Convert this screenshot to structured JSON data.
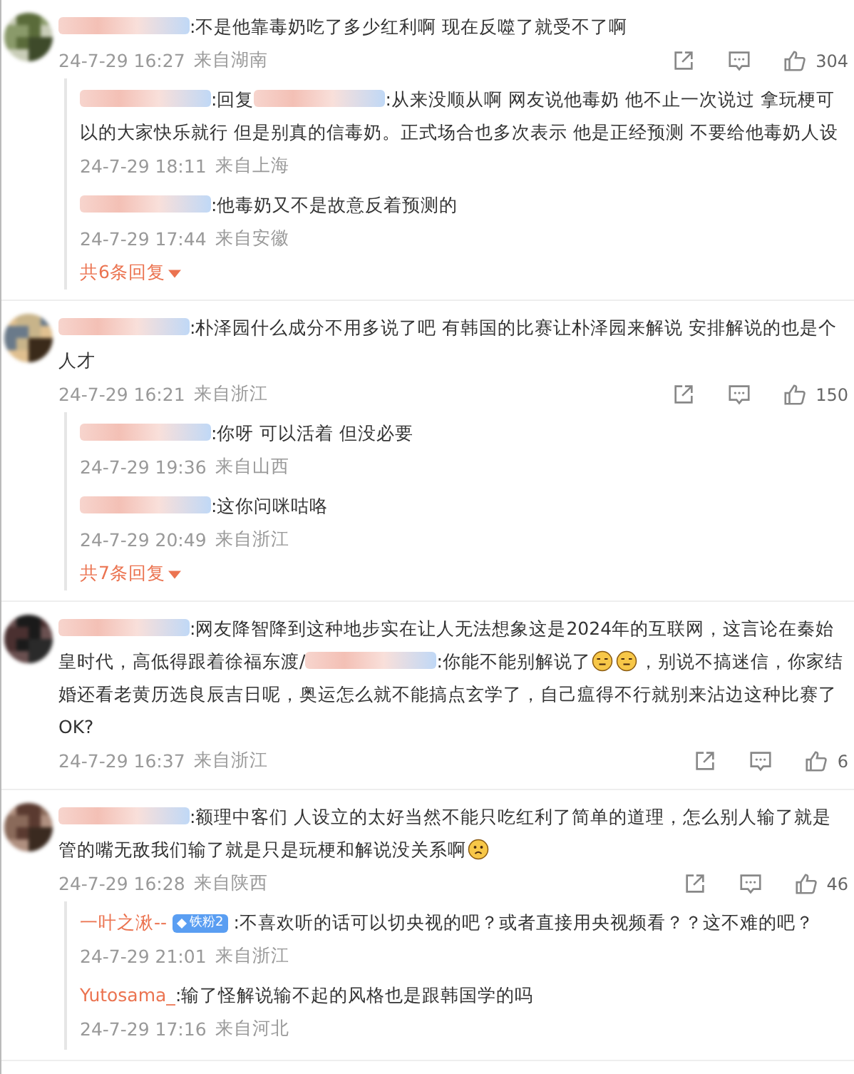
{
  "comments": [
    {
      "segments": [
        {
          "kind": "blur"
        },
        {
          "kind": "text",
          "text": ":不是他靠毒奶吃了多少红利啊  现在反噬了就受不了啊"
        }
      ],
      "time": "24-7-29 16:27",
      "location": "来自湖南",
      "likes": "304",
      "replies": [
        {
          "author": {
            "kind": "blur"
          },
          "segments": [
            {
              "kind": "text",
              "text": ":回复"
            },
            {
              "kind": "blur"
            },
            {
              "kind": "text",
              "text": ":从来没顺从啊 网友说他毒奶 他不止一次说过 拿玩梗可以的大家快乐就行 但是别真的信毒奶。正式场合也多次表示 他是正经预测 不要给他毒奶人设"
            }
          ],
          "time": "24-7-29 18:11",
          "location": "来自上海"
        },
        {
          "author": {
            "kind": "blur"
          },
          "segments": [
            {
              "kind": "text",
              "text": ":他毒奶又不是故意反着预测的"
            }
          ],
          "time": "24-7-29 17:44",
          "location": "来自安徽"
        }
      ],
      "more": "共6条回复"
    },
    {
      "segments": [
        {
          "kind": "blur"
        },
        {
          "kind": "text",
          "text": ":朴泽园什么成分不用多说了吧 有韩国的比赛让朴泽园来解说 安排解说的也是个人才"
        }
      ],
      "time": "24-7-29 16:21",
      "location": "来自浙江",
      "likes": "150",
      "replies": [
        {
          "author": {
            "kind": "blur"
          },
          "segments": [
            {
              "kind": "text",
              "text": ":你呀 可以活着 但没必要"
            }
          ],
          "time": "24-7-29 19:36",
          "location": "来自山西"
        },
        {
          "author": {
            "kind": "blur"
          },
          "segments": [
            {
              "kind": "text",
              "text": ":这你问咪咕咯"
            }
          ],
          "time": "24-7-29 20:49",
          "location": "来自浙江"
        }
      ],
      "more": "共7条回复"
    },
    {
      "segments": [
        {
          "kind": "blur"
        },
        {
          "kind": "text",
          "text": ":网友降智降到这种地步实在让人无法想象这是2024年的互联网，这言论在秦始皇时代，高低得跟着徐福东渡/"
        },
        {
          "kind": "blur"
        },
        {
          "kind": "text",
          "text": ":你能不能别解说了"
        },
        {
          "kind": "smirk_emoji"
        },
        {
          "kind": "smirk_emoji"
        },
        {
          "kind": "text",
          "text": "，别说不搞迷信，你家结婚还看老黄历选良辰吉日呢，奥运怎么就不能搞点玄学了，自己瘟得不行就别来沾边这种比赛了OK?"
        }
      ],
      "time": "24-7-29 16:37",
      "location": "来自浙江",
      "likes": "6"
    },
    {
      "segments": [
        {
          "kind": "blur"
        },
        {
          "kind": "text",
          "text": ":额理中客们 人设立的太好当然不能只吃红利了简单的道理，怎么别人输了就是管的嘴无敌我们输了就是只是玩梗和解说没关系啊"
        },
        {
          "kind": "sad_emoji"
        }
      ],
      "time": "24-7-29 16:28",
      "location": "来自陕西",
      "likes": "46",
      "replies": [
        {
          "author": {
            "kind": "named",
            "name": "一叶之湫--",
            "badge": "铁粉2"
          },
          "segments": [
            {
              "kind": "text",
              "text": ":不喜欢听的话可以切央视的吧？或者直接用央视频看？？这不难的吧？"
            }
          ],
          "time": "24-7-29 21:01",
          "location": "来自浙江"
        },
        {
          "author": {
            "kind": "named",
            "name": "Yutosama_"
          },
          "segments": [
            {
              "kind": "text",
              "text": ":输了怪解说输不起的风格也是跟韩国学的吗"
            }
          ],
          "time": "24-7-29 17:16",
          "location": "来自河北"
        }
      ]
    }
  ]
}
